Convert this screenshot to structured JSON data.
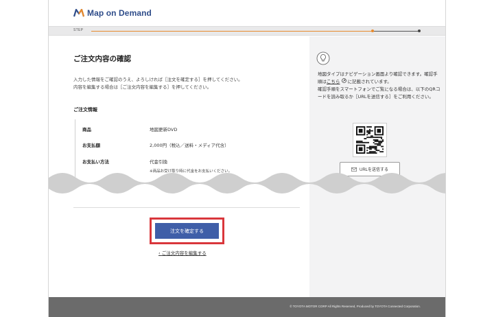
{
  "brand": {
    "name": "Map on Demand",
    "color": "#2f4d8a",
    "accent": "#e88a2c"
  },
  "stepbar": {
    "label": "STEP"
  },
  "main": {
    "title": "ご注文内容の確認",
    "intro_line1": "入力した情報をご確認のうえ、よろしければ［注文を確定する］を押してください。",
    "intro_line2": "内容を編集する場合は［ご注文内容を編集する］を押してください。",
    "section_title": "ご注文情報",
    "rows": [
      {
        "label": "商品",
        "value": "地図更新DVD"
      },
      {
        "label": "お支払額",
        "value": "2,000円（税込／送料・メディア代含）"
      },
      {
        "label": "お支払い方法",
        "value": "代金引換"
      }
    ],
    "payment_note": "※商品お受け取り時に代金をお支払いください。",
    "confirm_label": "注文を確定する",
    "edit_link": "ご注文内容を編集する",
    "highlight_color": "#d9363b",
    "button_color": "#3f5ea8"
  },
  "side": {
    "text_part1": "地図タイプはナビゲーション画面より確認できます。確認手順は",
    "link": "こちら",
    "text_part2": "に記載されています。",
    "text_part3": "確認手順をスマートフォンでご覧になる場合は、以下のQRコードを読み取るか［URLを送信する］をご利用ください。",
    "send_button": "URLを送信する",
    "icons": [
      "lightbulb-icon",
      "external-link-icon",
      "qr-code",
      "mail-icon"
    ]
  },
  "footer": {
    "copyright": "© TOYOTA MOTOR CORP All Rights Reserved, Produced by TOYOTA Connected Corporation."
  }
}
